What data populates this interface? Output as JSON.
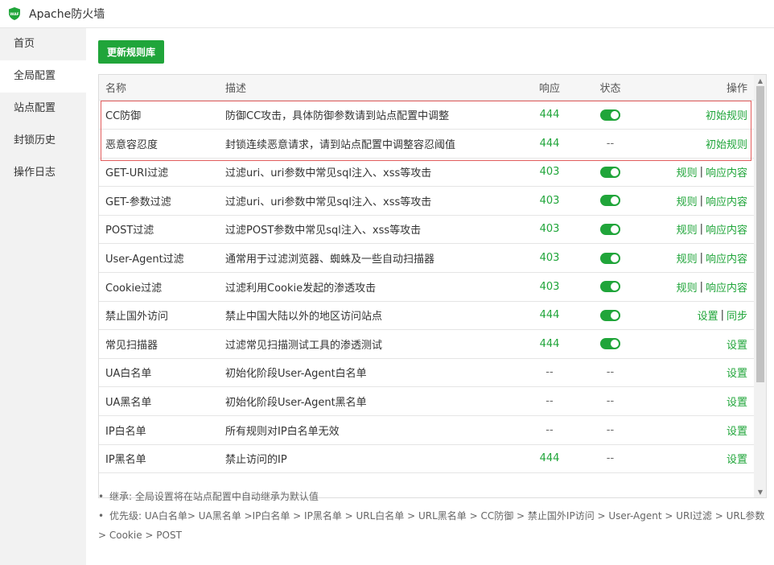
{
  "app": {
    "title": "Apache防火墙",
    "logo_text": "WAF"
  },
  "sidebar": {
    "items": [
      {
        "label": "首页",
        "active": false
      },
      {
        "label": "全局配置",
        "active": true
      },
      {
        "label": "站点配置",
        "active": false
      },
      {
        "label": "封锁历史",
        "active": false
      },
      {
        "label": "操作日志",
        "active": false
      }
    ]
  },
  "toolbar": {
    "update_label": "更新规则库"
  },
  "table": {
    "headers": {
      "name": "名称",
      "desc": "描述",
      "resp": "响应",
      "status": "状态",
      "op": "操作"
    },
    "rows": [
      {
        "name": "CC防御",
        "desc": "防御CC攻击，具体防御参数请到站点配置中调整",
        "resp": "444",
        "status": "on",
        "ops": [
          "初始规则"
        ]
      },
      {
        "name": "恶意容忍度",
        "desc": "封锁连续恶意请求，请到站点配置中调整容忍阈值",
        "resp": "444",
        "status": "--",
        "ops": [
          "初始规则"
        ]
      },
      {
        "name": "GET-URI过滤",
        "desc": "过滤uri、uri参数中常见sql注入、xss等攻击",
        "resp": "403",
        "status": "on",
        "ops": [
          "规则",
          "响应内容"
        ]
      },
      {
        "name": "GET-参数过滤",
        "desc": "过滤uri、uri参数中常见sql注入、xss等攻击",
        "resp": "403",
        "status": "on",
        "ops": [
          "规则",
          "响应内容"
        ]
      },
      {
        "name": "POST过滤",
        "desc": "过滤POST参数中常见sql注入、xss等攻击",
        "resp": "403",
        "status": "on",
        "ops": [
          "规则",
          "响应内容"
        ]
      },
      {
        "name": "User-Agent过滤",
        "desc": "通常用于过滤浏览器、蜘蛛及一些自动扫描器",
        "resp": "403",
        "status": "on",
        "ops": [
          "规则",
          "响应内容"
        ]
      },
      {
        "name": "Cookie过滤",
        "desc": "过滤利用Cookie发起的渗透攻击",
        "resp": "403",
        "status": "on",
        "ops": [
          "规则",
          "响应内容"
        ]
      },
      {
        "name": "禁止国外访问",
        "desc": "禁止中国大陆以外的地区访问站点",
        "resp": "444",
        "status": "on",
        "ops": [
          "设置",
          "同步"
        ]
      },
      {
        "name": "常见扫描器",
        "desc": "过滤常见扫描测试工具的渗透测试",
        "resp": "444",
        "status": "on",
        "ops": [
          "设置"
        ]
      },
      {
        "name": "UA白名单",
        "desc": "初始化阶段User-Agent白名单",
        "resp": "--",
        "status": "--",
        "ops": [
          "设置"
        ]
      },
      {
        "name": "UA黑名单",
        "desc": "初始化阶段User-Agent黑名单",
        "resp": "--",
        "status": "--",
        "ops": [
          "设置"
        ]
      },
      {
        "name": "IP白名单",
        "desc": "所有规则对IP白名单无效",
        "resp": "--",
        "status": "--",
        "ops": [
          "设置"
        ]
      },
      {
        "name": "IP黑名单",
        "desc": "禁止访问的IP",
        "resp": "444",
        "status": "--",
        "ops": [
          "设置"
        ]
      }
    ]
  },
  "notes": [
    "继承: 全局设置将在站点配置中自动继承为默认值",
    "优先级: UA白名单> UA黑名单 >IP白名单 > IP黑名单 > URL白名单 > URL黑名单 > CC防御 > 禁止国外IP访问 > User-Agent > URI过滤 > URL参数 > Cookie > POST"
  ],
  "colors": {
    "accent": "#20a53a",
    "highlight": "#e25d5d"
  }
}
